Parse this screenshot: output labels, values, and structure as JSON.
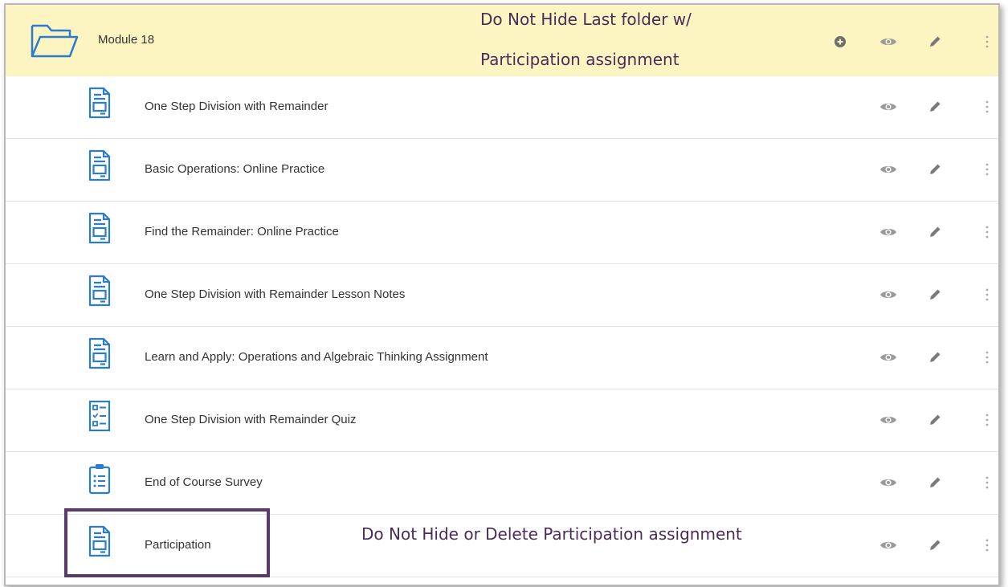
{
  "module": {
    "title": "Module 18",
    "note_line1": "Do Not Hide Last folder w/",
    "note_line2": "Participation assignment"
  },
  "items": [
    {
      "label": "One Step Division with Remainder",
      "icon": "assignment-icon"
    },
    {
      "label": "Basic Operations: Online Practice",
      "icon": "assignment-icon"
    },
    {
      "label": "Find the Remainder: Online Practice",
      "icon": "assignment-icon"
    },
    {
      "label": "One Step Division with Remainder Lesson Notes",
      "icon": "assignment-icon"
    },
    {
      "label": "Learn and Apply: Operations and Algebraic Thinking Assignment",
      "icon": "assignment-icon"
    },
    {
      "label": "One Step Division with Remainder Quiz",
      "icon": "quiz-icon"
    },
    {
      "label": "End of Course Survey",
      "icon": "survey-icon"
    },
    {
      "label": "Participation",
      "icon": "assignment-icon"
    }
  ],
  "participation_note": "Do Not Hide or Delete Participation assignment",
  "colors": {
    "header_bg": "#fcf5c2",
    "icon_blue": "#2b7bd1",
    "annotation": "#4b2b59"
  }
}
